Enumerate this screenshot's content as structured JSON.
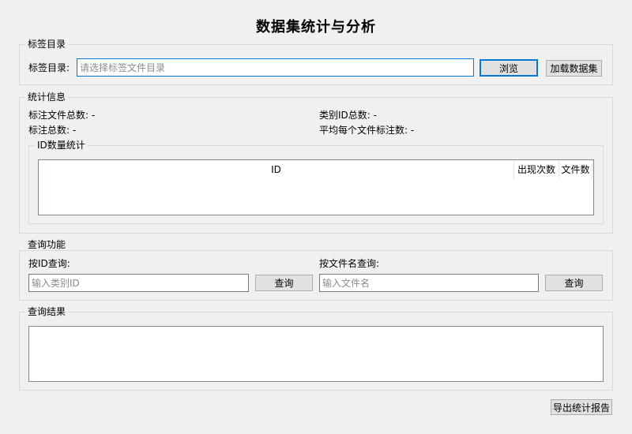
{
  "window": {
    "title": "数据集统计与分析"
  },
  "label_dir": {
    "group_title": "标签目录",
    "field_label": "标签目录:",
    "input_placeholder": "请选择标签文件目录",
    "browse_button": "浏览",
    "load_button": "加载数据集"
  },
  "stats": {
    "group_title": "统计信息",
    "total_files_label": "标注文件总数:",
    "total_files_value": "-",
    "total_classes_label": "类别ID总数:",
    "total_classes_value": "-",
    "total_annotations_label": "标注总数:",
    "total_annotations_value": "-",
    "avg_per_file_label": "平均每个文件标注数:",
    "avg_per_file_value": "-",
    "id_stats": {
      "group_title": "ID数量统计",
      "columns": [
        "ID",
        "出现次数",
        "文件数"
      ]
    }
  },
  "query": {
    "group_title": "查询功能",
    "by_id_label": "按ID查询:",
    "by_id_placeholder": "输入类别ID",
    "by_id_button": "查询",
    "by_file_label": "按文件名查询:",
    "by_file_placeholder": "输入文件名",
    "by_file_button": "查询"
  },
  "results": {
    "group_title": "查询结果"
  },
  "export_button": "导出统计报告"
}
